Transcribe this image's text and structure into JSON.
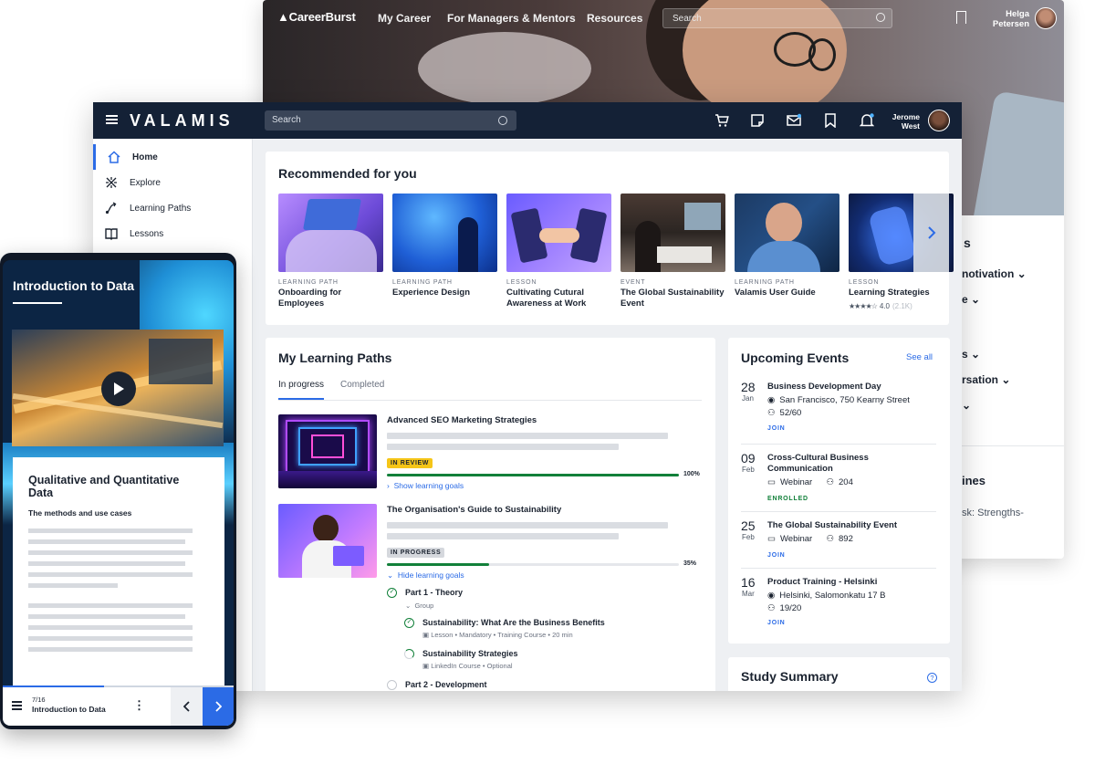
{
  "careerburst": {
    "logo": "CareerBurst",
    "nav": [
      "My Career",
      "For Managers & Mentors",
      "Resources"
    ],
    "search_placeholder": "Search",
    "user_first": "Helga",
    "user_last": "Petersen",
    "side_texts": [
      "s",
      "notivation",
      "e",
      "s",
      "rsation",
      "ines",
      "sk: Strengths-"
    ]
  },
  "valamis": {
    "logo": "VALAMIS",
    "search_placeholder": "Search",
    "user_first": "Jerome",
    "user_last": "West",
    "sidebar": [
      {
        "label": "Home",
        "icon": "home-icon"
      },
      {
        "label": "Explore",
        "icon": "explore-icon"
      },
      {
        "label": "Learning Paths",
        "icon": "path-icon"
      },
      {
        "label": "Lessons",
        "icon": "book-icon"
      }
    ],
    "recommended": {
      "title": "Recommended for you",
      "items": [
        {
          "type": "LEARNING PATH",
          "title": "Onboarding for Employees"
        },
        {
          "type": "LEARNING PATH",
          "title": "Experience Design"
        },
        {
          "type": "LESSON",
          "title": "Cultivating Cutural Awareness at Work"
        },
        {
          "type": "EVENT",
          "title": "The Global Sustainability Event"
        },
        {
          "type": "LEARNING PATH",
          "title": "Valamis User Guide"
        },
        {
          "type": "LESSON",
          "title": "Learning Strategies",
          "rating": "4.0",
          "rating_count": "(2.1K)"
        }
      ]
    },
    "learning_paths": {
      "title": "My Learning Paths",
      "tabs": [
        "In progress",
        "Completed"
      ],
      "paths": [
        {
          "title": "Advanced SEO Marketing Strategies",
          "status": "IN REVIEW",
          "progress": 100,
          "progress_label": "100%",
          "goals_link": "Show learning goals"
        },
        {
          "title": "The Organisation's Guide to Sustainability",
          "status": "IN PROGRESS",
          "progress": 35,
          "progress_label": "35%",
          "goals_link": "Hide learning goals"
        }
      ],
      "goals": {
        "part1": "Part 1 - Theory",
        "group": "Group",
        "items": [
          {
            "title": "Sustainability: What Are the Business Benefits",
            "meta": "Lesson • Mandatory • Training Course • 20 min"
          },
          {
            "title": "Sustainability Strategies",
            "meta": "LinkedIn Course • Optional"
          }
        ],
        "part2": "Part 2 - Development"
      }
    },
    "events": {
      "title": "Upcoming Events",
      "see_all": "See all",
      "items": [
        {
          "day": "28",
          "month": "Jan",
          "title": "Business Development Day",
          "location": "San Francisco, 750 Kearny Street",
          "attendees": "52/60",
          "action": "JOIN"
        },
        {
          "day": "09",
          "month": "Feb",
          "title": "Cross-Cultural Business Communication",
          "location": "Webinar",
          "attendees": "204",
          "action": "ENROLLED"
        },
        {
          "day": "25",
          "month": "Feb",
          "title": "The Global Sustainability Event",
          "location": "Webinar",
          "attendees": "892",
          "action": "JOIN"
        },
        {
          "day": "16",
          "month": "Mar",
          "title": "Product Training - Helsinki",
          "location": "Helsinki, Salomonkatu 17 B",
          "attendees": "19/20",
          "action": "JOIN"
        }
      ]
    },
    "study_summary": {
      "title": "Study Summary",
      "help": "?"
    }
  },
  "phone": {
    "title": "Introduction to Data",
    "card_title": "Qualitative and Quantitative Data",
    "card_subtitle": "The methods and use cases",
    "counter": "7/16",
    "footer_title": "Introduction to Data",
    "progress": 0.44
  },
  "colors": {
    "accent": "#2b6be6",
    "navy": "#142136",
    "success": "#12803a",
    "review": "#f5c518"
  }
}
